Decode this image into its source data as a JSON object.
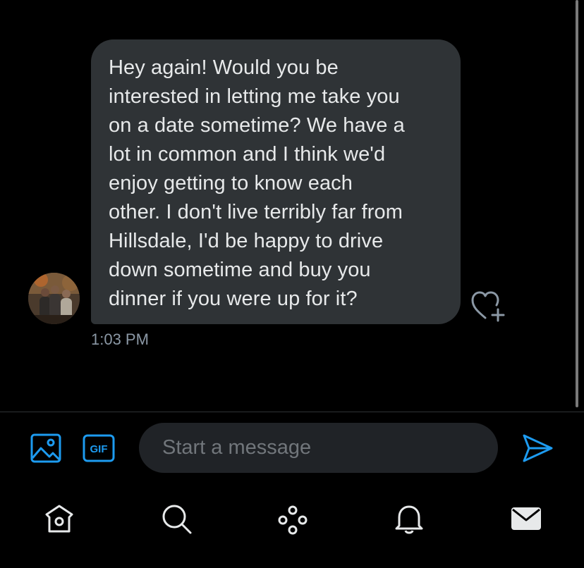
{
  "conversation": {
    "message": {
      "text": "Hey again! Would you be\ninterested in letting me take you\non a date sometime? We have a\nlot in common and I think we'd\nenjoy getting to know each\nother. I don't live terribly far from\nHillsdale, I'd be happy to drive\ndown sometime and buy you\ndinner if you were up for it?",
      "time": "1:03 PM"
    }
  },
  "composer": {
    "placeholder": "Start a message",
    "gif_label": "GIF",
    "accent_color": "#1d9bf0"
  },
  "bottom_nav": {
    "items": [
      {
        "icon": "home-icon"
      },
      {
        "icon": "search-icon"
      },
      {
        "icon": "spaces-icon"
      },
      {
        "icon": "notifications-bell-icon"
      },
      {
        "icon": "messages-envelope-icon"
      }
    ]
  }
}
